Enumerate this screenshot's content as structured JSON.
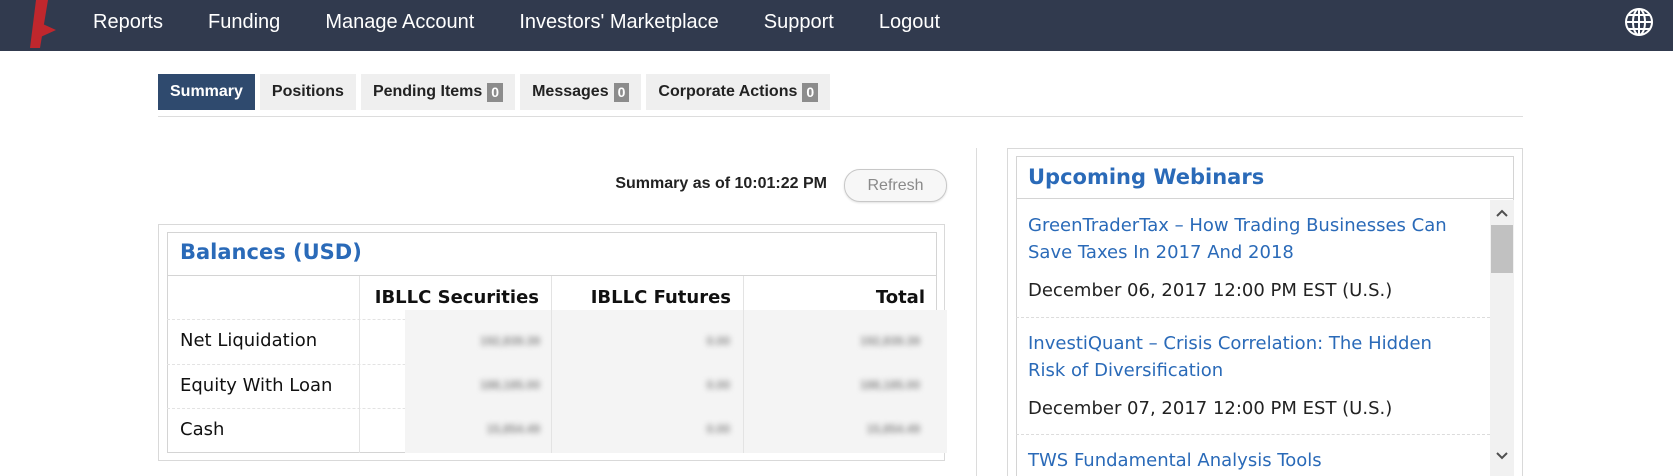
{
  "nav": {
    "items": [
      "Reports",
      "Funding",
      "Manage Account",
      "Investors' Marketplace",
      "Support",
      "Logout"
    ]
  },
  "tabs": [
    {
      "label": "Summary",
      "count": null
    },
    {
      "label": "Positions",
      "count": null
    },
    {
      "label": "Pending Items",
      "count": "0"
    },
    {
      "label": "Messages",
      "count": "0"
    },
    {
      "label": "Corporate Actions",
      "count": "0"
    }
  ],
  "summary": {
    "as_of": "Summary as of 10:01:22 PM",
    "refresh_label": "Refresh"
  },
  "balances": {
    "title": "Balances (USD)",
    "columns": [
      "IBLLC Securities",
      "IBLLC Futures",
      "Total"
    ],
    "rows": [
      {
        "label": "Net Liquidation",
        "values": [
          "192,839.39",
          "0.00",
          "192,839.39"
        ]
      },
      {
        "label": "Equity With Loan",
        "values": [
          "188,185.00",
          "0.00",
          "188,185.00"
        ]
      },
      {
        "label": "Cash",
        "values": [
          "15,854.49",
          "0.00",
          "15,854.49"
        ]
      }
    ]
  },
  "webinars": {
    "title": "Upcoming Webinars",
    "items": [
      {
        "title": "GreenTraderTax – How Trading Businesses Can Save Taxes In 2017 And 2018",
        "date": "December 06, 2017 12:00 PM EST (U.S.)"
      },
      {
        "title": "InvestiQuant – Crisis Correlation: The Hidden Risk of Diversification",
        "date": "December 07, 2017 12:00 PM EST (U.S.)"
      },
      {
        "title": "TWS Fundamental Analysis Tools",
        "date": ""
      }
    ]
  },
  "icons": {
    "logo": "ib-logo-icon",
    "globe": "globe-icon",
    "scroll_up": "chevron-up-icon",
    "scroll_down": "chevron-down-icon"
  },
  "colors": {
    "nav_bg": "#313a4e",
    "active_tab": "#2f4a6e",
    "link": "#2a6ab8",
    "logo_red": "#c0272d"
  }
}
